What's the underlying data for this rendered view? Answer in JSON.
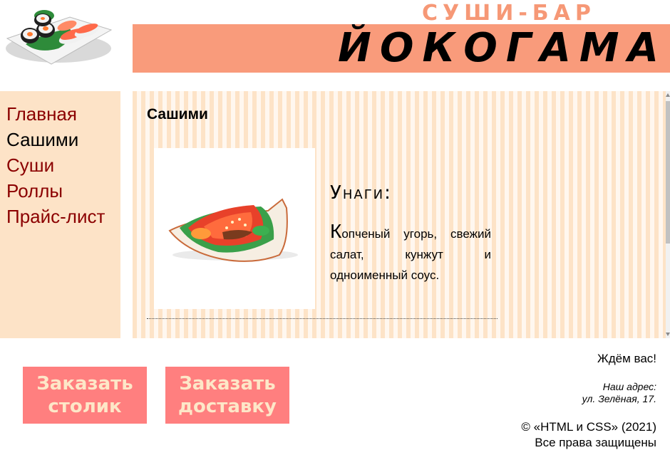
{
  "header": {
    "subtitle": "СУШИ-БАР",
    "title": "ЙОКОГАМА",
    "banner_color": "#f99b7b",
    "logo_icon": "sushi-plate-icon"
  },
  "menu": {
    "items": [
      {
        "label": "Главная",
        "active": false
      },
      {
        "label": "Сашими",
        "active": true
      },
      {
        "label": "Суши",
        "active": false
      },
      {
        "label": "Роллы",
        "active": false
      },
      {
        "label": "Прайс-лист",
        "active": false
      }
    ],
    "background": "#fde3c7",
    "link_color": "#8b0000"
  },
  "content": {
    "title": "Сашими",
    "item": {
      "name": "Унаги:",
      "description_first_letter": "К",
      "description_rest": "опченый угорь, свежий салат, кунжут и одноименный соус.",
      "photo_icon": "sashimi-dish-icon"
    }
  },
  "buttons": {
    "order_table": "Заказать\nстолик",
    "order_delivery": "Заказать\nдоставку",
    "color": "#ff7f7f",
    "text_color": "#fde7c8"
  },
  "footer": {
    "welcome": "Ждём вас!",
    "address_label": "Наш адрес:",
    "address": "ул. Зелёная, 17.",
    "copyright": "© «HTML и CSS» (2021)",
    "rights": "Все права защищены"
  }
}
